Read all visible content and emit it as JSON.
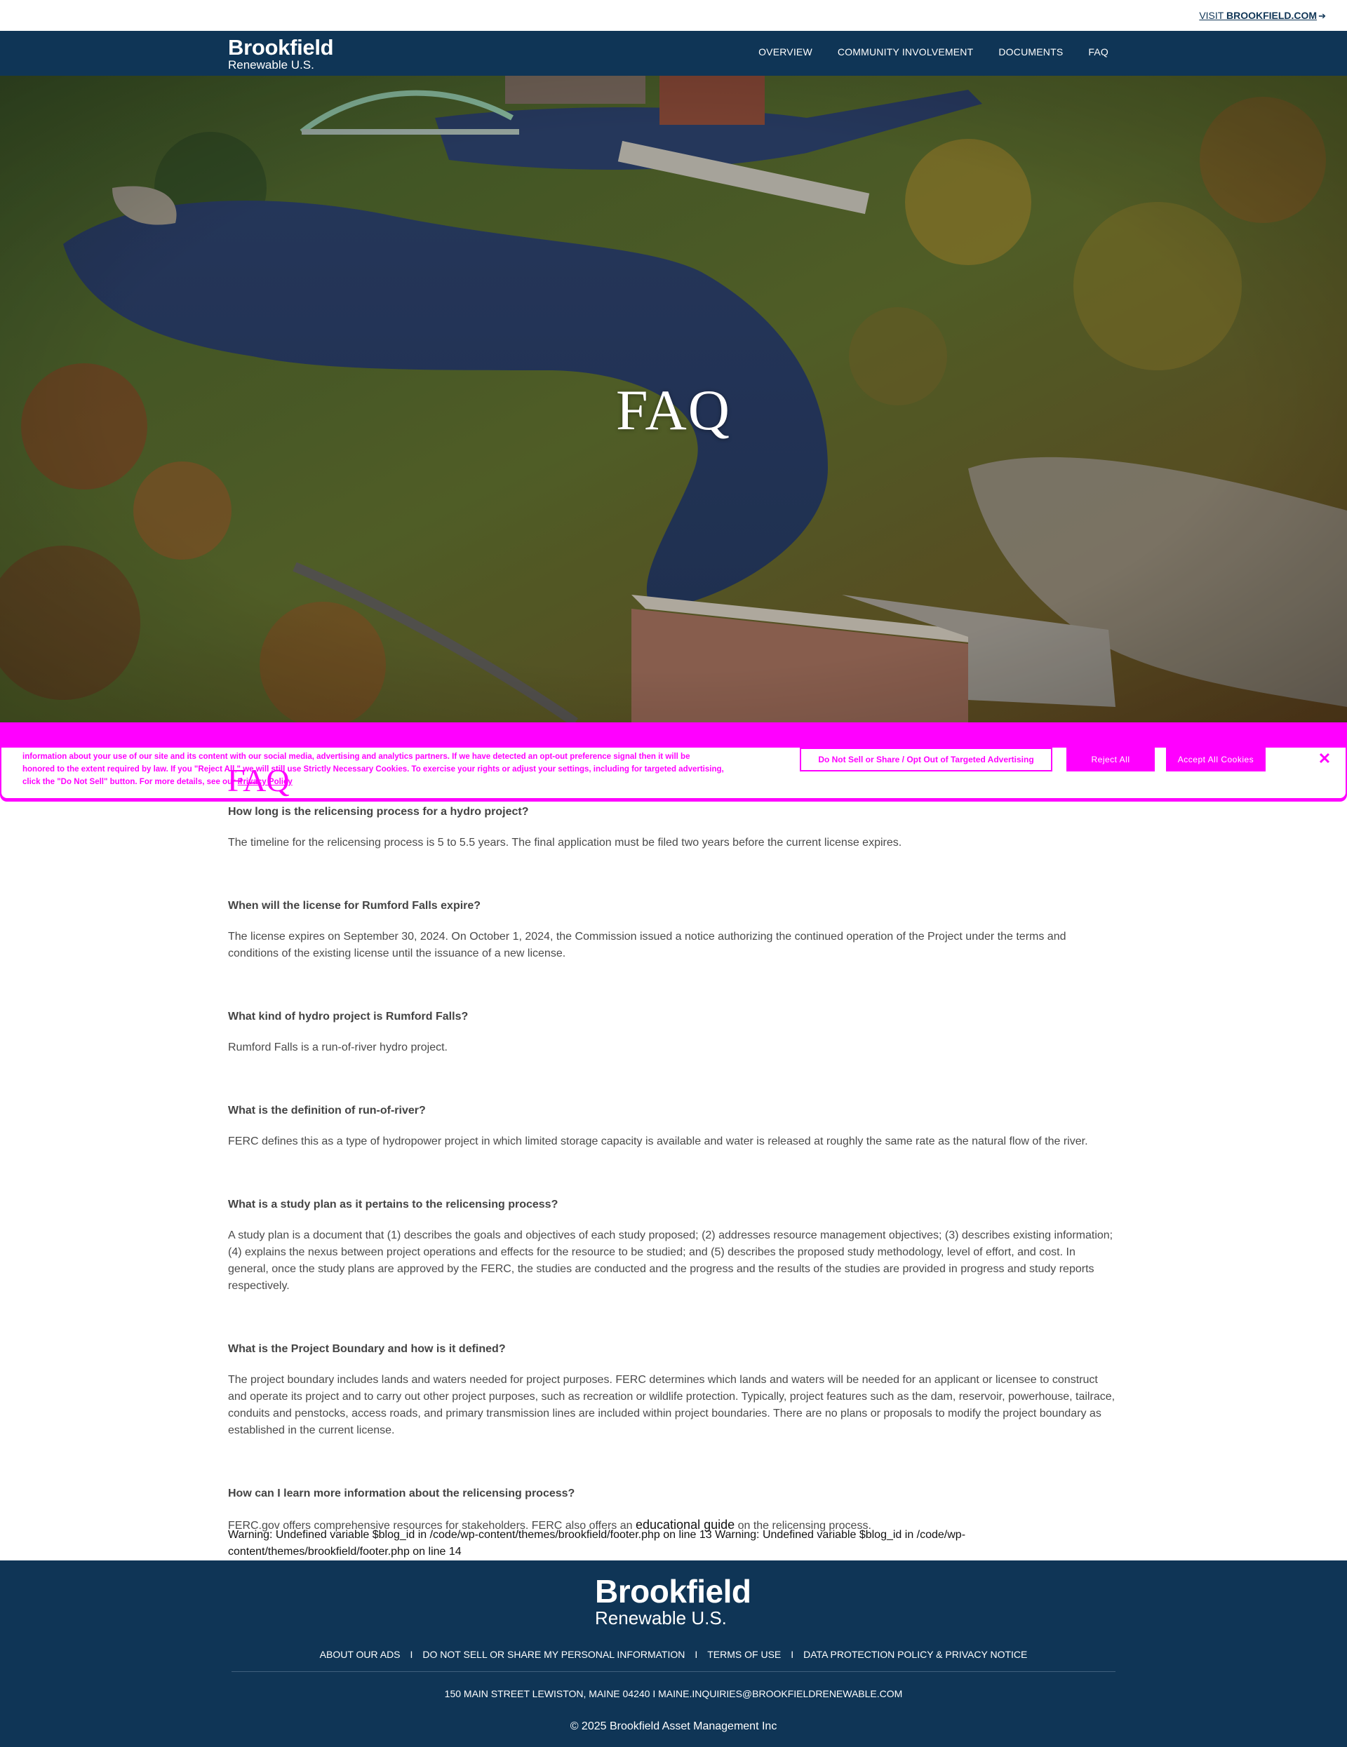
{
  "topbar": {
    "visit_prefix": "VISIT ",
    "visit_site": "BROOKFIELD.COM",
    "arrow_icon": "arrow-right-icon"
  },
  "header": {
    "logo_line1": "Brookfield",
    "logo_line2": "Renewable U.S.",
    "nav": [
      {
        "label": "OVERVIEW"
      },
      {
        "label": "COMMUNITY INVOLVEMENT"
      },
      {
        "label": "DOCUMENTS"
      },
      {
        "label": "FAQ"
      }
    ]
  },
  "hero": {
    "title": "FAQ"
  },
  "cookie_banner": {
    "text": "information about your use of our site and its content with our social media, advertising and analytics partners. If we have detected an opt-out preference signal then it will be honored to the extent required by law. If you \"Reject All,\" we will still use Strictly Necessary Cookies. To exercise your rights or adjust your settings, including for targeted advertising, click the \"Do Not Sell\" button. For more details, see our",
    "privacy_link": "Privacy Policy",
    "do_not_sell_button": "Do Not Sell or Share / Opt Out of Targeted Advertising",
    "reject_button": "Reject All",
    "accept_button": "Accept All Cookies",
    "close_icon": "close-icon",
    "accent_color": "#ff00ff"
  },
  "faq_heading": "FAQ",
  "faq": [
    {
      "q": "How long is the relicensing process for a hydro project?",
      "a": "The timeline for the relicensing process is 5 to 5.5 years.  The final application must be filed two years before the current license expires."
    },
    {
      "q": "When will the license for Rumford Falls expire?",
      "a": "The license expires on September 30, 2024. On October 1, 2024, the Commission issued a notice authorizing the continued operation of the Project under the terms and conditions of the existing license until the issuance of a new license."
    },
    {
      "q": "What kind of hydro project is Rumford Falls?",
      "a": "Rumford Falls is a run-of-river hydro project."
    },
    {
      "q": "What is the definition of run-of-river?",
      "a": "FERC defines this as a type of hydropower project in which limited storage capacity is available and water is released at roughly the same rate as the natural flow of the river."
    },
    {
      "q": "What is a study plan as it pertains to the relicensing process?",
      "a": "A study plan is a document that (1) describes the goals and objectives of each study proposed; (2) addresses resource management objectives; (3) describes existing information; (4) explains the nexus between project operations and effects for the resource to be studied; and (5) describes the proposed study methodology, level of effort, and cost.  In general, once the study plans are approved by the FERC, the studies are conducted and the progress and the results of the studies are provided in progress and study reports respectively."
    },
    {
      "q": "What is the Project Boundary and how is it defined?",
      "a": "The project boundary includes lands and waters needed for project purposes.  FERC determines which lands and waters will be needed for an applicant or licensee to construct and operate its project and to carry out other project purposes, such as recreation or wildlife protection.  Typically, project features such as the dam, reservoir, powerhouse, tailrace, conduits and penstocks, access roads, and primary transmission lines are included within project boundaries.  There are no plans or proposals to modify the project boundary as established in the current license."
    },
    {
      "q": "How can I learn more information about the relicensing process?",
      "a_before": "FERC.gov offers comprehensive resources for stakeholders.  FERC also offers an ",
      "a_link": "educational guide",
      "a_after": " on the relicensing process."
    }
  ],
  "warning": "Warning: Undefined variable $blog_id in /code/wp-content/themes/brookfield/footer.php on line 13 Warning: Undefined variable $blog_id in /code/wp-content/themes/brookfield/footer.php on line 14",
  "footer": {
    "logo_line1": "Brookfield",
    "logo_line2": "Renewable U.S.",
    "links": [
      {
        "label": "ABOUT OUR ADS"
      },
      {
        "label": "DO NOT SELL OR SHARE MY PERSONAL INFORMATION"
      },
      {
        "label": "TERMS OF USE"
      },
      {
        "label": "DATA PROTECTION POLICY & PRIVACY NOTICE"
      }
    ],
    "separator": "I",
    "address": "150 MAIN STREET LEWISTON, MAINE 04240 I MAINE.INQUIRIES@BROOKFIELDRENEWABLE.COM",
    "copyright": "© 2025 Brookfield Asset Management Inc"
  },
  "colors": {
    "navy": "#0f3556",
    "body_text": "#4a4a4a",
    "cookie_magenta": "#ff00ff"
  }
}
